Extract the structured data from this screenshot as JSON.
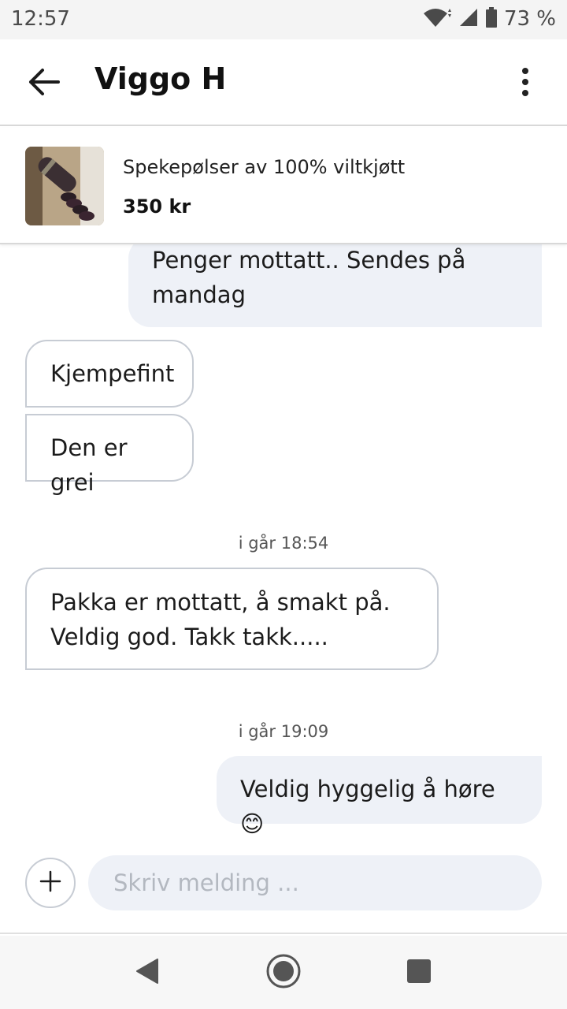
{
  "status_bar": {
    "time": "12:57",
    "battery_percent": "73 %",
    "icons": [
      "wifi-icon",
      "signal-icon",
      "battery-icon"
    ]
  },
  "header": {
    "title": "Viggo H",
    "icons": [
      "back-arrow-icon",
      "more-vert-icon"
    ]
  },
  "listing": {
    "title": "Spekepølser av 100% viltkjøtt",
    "price": "350 kr"
  },
  "messages": [
    {
      "direction": "outgoing",
      "lines": [
        "Penger mottatt.. Sendes på",
        "mandag"
      ]
    },
    {
      "direction": "incoming",
      "lines": [
        "Kjempefint"
      ]
    },
    {
      "direction": "incoming",
      "lines": [
        "Den er grei"
      ]
    },
    {
      "timestamp": "i går 18:54"
    },
    {
      "direction": "incoming",
      "lines": [
        "Pakka er mottatt, å smakt på.",
        "Veldig god. Takk takk....."
      ]
    },
    {
      "timestamp": "i går 19:09"
    },
    {
      "direction": "outgoing",
      "lines": [
        "Veldig hyggelig å høre 😊"
      ]
    }
  ],
  "composer": {
    "placeholder": "Skriv melding ...",
    "value": "",
    "add_icon": "plus-icon"
  },
  "navbar": {
    "icons": [
      "back-triangle-icon",
      "home-circle-icon",
      "recents-square-icon"
    ]
  },
  "colors": {
    "outgoing_bubble": "#eef1f7",
    "incoming_border": "#c7ccd4",
    "text": "#1b1b1b"
  }
}
